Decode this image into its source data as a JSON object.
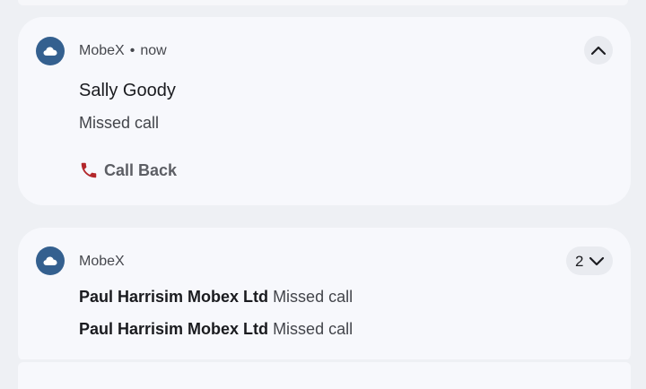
{
  "notification_1": {
    "app_name": "MobeX",
    "separator": "•",
    "time": "now",
    "title": "Sally Goody",
    "message": "Missed call",
    "action_label": "Call Back"
  },
  "notification_2": {
    "app_name": "MobeX",
    "count": "2",
    "rows": [
      {
        "sender": "Paul Harrisim Mobex Ltd",
        "message": "Missed call"
      },
      {
        "sender": "Paul Harrisim Mobex Ltd",
        "message": "Missed call"
      }
    ]
  },
  "colors": {
    "app_icon": "#34608f",
    "card_background": "#f7f8fc",
    "shade_background": "#eef0f4"
  },
  "icons": {
    "app": "cloud-icon",
    "collapse": "chevron-up-icon",
    "expand": "chevron-down-icon",
    "call": "phone-icon"
  }
}
